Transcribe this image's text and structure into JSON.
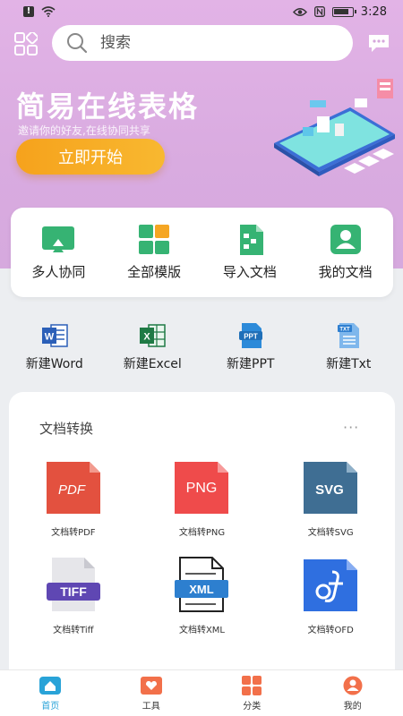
{
  "status": {
    "time": "3:28"
  },
  "search": {
    "placeholder": "搜索"
  },
  "banner": {
    "title": "简易在线表格",
    "subtitle": "邀请你的好友,在线协同共享",
    "start_label": "立即开始"
  },
  "quick": [
    {
      "label": "多人协同",
      "icon": "monitor-icon"
    },
    {
      "label": "全部模版",
      "icon": "templates-grid-icon"
    },
    {
      "label": "导入文档",
      "icon": "import-sheet-icon"
    },
    {
      "label": "我的文档",
      "icon": "my-doc-icon"
    }
  ],
  "new_docs": [
    {
      "label": "新建Word",
      "icon": "word-icon"
    },
    {
      "label": "新建Excel",
      "icon": "excel-icon"
    },
    {
      "label": "新建PPT",
      "icon": "ppt-icon"
    },
    {
      "label": "新建Txt",
      "icon": "txt-icon"
    }
  ],
  "convert": {
    "title": "文档转换",
    "more": "···",
    "items": [
      {
        "label": "文档转PDF",
        "badge": "PDF",
        "icon": "pdf-file-icon"
      },
      {
        "label": "文档转PNG",
        "badge": "PNG",
        "icon": "png-file-icon"
      },
      {
        "label": "文档转SVG",
        "badge": "SVG",
        "icon": "svg-file-icon"
      },
      {
        "label": "文档转Tiff",
        "badge": "TIFF",
        "icon": "tiff-file-icon"
      },
      {
        "label": "文档转XML",
        "badge": "XML",
        "icon": "xml-file-icon"
      },
      {
        "label": "文档转OFD",
        "badge": "",
        "icon": "ofd-file-icon"
      }
    ]
  },
  "tabs": [
    {
      "label": "首页",
      "icon": "home-icon",
      "active": true
    },
    {
      "label": "工具",
      "icon": "tools-icon",
      "active": false
    },
    {
      "label": "分类",
      "icon": "category-icon",
      "active": false
    },
    {
      "label": "我的",
      "icon": "profile-icon",
      "active": false
    }
  ],
  "colors": {
    "banner_bg": "#dcaee2",
    "accent_orange": "#f7a823",
    "tab_active": "#29a3d8"
  }
}
